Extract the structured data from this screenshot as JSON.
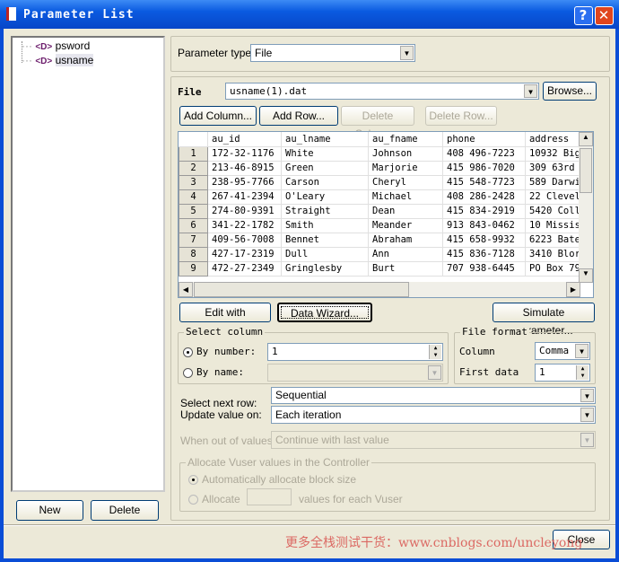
{
  "window": {
    "title": "Parameter List",
    "help": "?",
    "close": "✕"
  },
  "tree": {
    "items": [
      {
        "label": "psword",
        "icon": "<D>"
      },
      {
        "label": "usname",
        "icon": "<D>"
      }
    ]
  },
  "left_buttons": {
    "new": "New",
    "delete": "Delete"
  },
  "param_type": {
    "label": "Parameter type:",
    "value": "File"
  },
  "file": {
    "label": "File",
    "value": "usname(1).dat",
    "browse": "Browse..."
  },
  "table_buttons": {
    "add_column": "Add Column...",
    "add_row": "Add Row...",
    "delete_column": "Delete Column...",
    "delete_row": "Delete Row..."
  },
  "table": {
    "columns": [
      "au_id",
      "au_lname",
      "au_fname",
      "phone",
      "address"
    ],
    "rows": [
      [
        "1",
        "172-32-1176",
        "White",
        "Johnson",
        "408 496-7223",
        "10932 Big"
      ],
      [
        "2",
        "213-46-8915",
        "Green",
        "Marjorie",
        "415 986-7020",
        "309 63rd"
      ],
      [
        "3",
        "238-95-7766",
        "Carson",
        "Cheryl",
        "415 548-7723",
        "589 Darwi"
      ],
      [
        "4",
        "267-41-2394",
        "O'Leary",
        "Michael",
        "408 286-2428",
        "22 Clevel"
      ],
      [
        "5",
        "274-80-9391",
        "Straight",
        "Dean",
        "415 834-2919",
        "5420 Coll"
      ],
      [
        "6",
        "341-22-1782",
        "Smith",
        "Meander",
        "913 843-0462",
        "10 Missis"
      ],
      [
        "7",
        "409-56-7008",
        "Bennet",
        "Abraham",
        "415 658-9932",
        "6223 Bate"
      ],
      [
        "8",
        "427-17-2319",
        "Dull",
        "Ann",
        "415 836-7128",
        "3410 Blor"
      ],
      [
        "9",
        "472-27-2349",
        "Gringlesby",
        "Burt",
        "707 938-6445",
        "PO Box 79"
      ]
    ]
  },
  "actions": {
    "edit_notepad": "Edit with Notepad...",
    "data_wizard": "Data Wizard...",
    "simulate": "Simulate Parameter..."
  },
  "select_column": {
    "legend": "Select column",
    "by_number": "By number:",
    "number_value": "1",
    "by_name": "By name:"
  },
  "file_format": {
    "legend": "File format",
    "column_label": "Column",
    "column_value": "Comma",
    "first_data_label": "First data",
    "first_data_value": "1"
  },
  "select_next_row": {
    "label": "Select next row:",
    "value": "Sequential"
  },
  "update_value": {
    "label": "Update value on:",
    "value": "Each iteration"
  },
  "out_of_values": {
    "label": "When out of values:",
    "value": "Continue with last value"
  },
  "allocate": {
    "legend": "Allocate Vuser values in the Controller",
    "auto": "Automatically allocate block size",
    "manual": "Allocate",
    "manual_suffix": "values for each Vuser"
  },
  "close_button": "Close",
  "watermark": "更多全栈测试干货：www.cnblogs.com/uncleyong"
}
